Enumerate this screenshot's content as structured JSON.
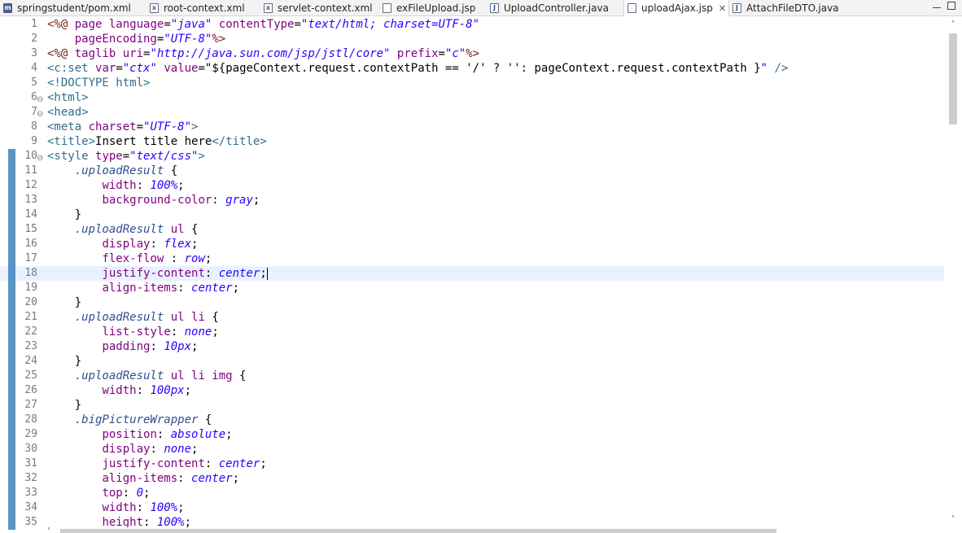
{
  "tabs": [
    {
      "label": "springstudent/pom.xml",
      "icon": "maven-file-icon",
      "active": false
    },
    {
      "label": "root-context.xml",
      "icon": "xml-file-icon",
      "active": false
    },
    {
      "label": "servlet-context.xml",
      "icon": "xml-file-icon",
      "active": false
    },
    {
      "label": "exFileUpload.jsp",
      "icon": "jsp-file-icon",
      "active": false
    },
    {
      "label": "UploadController.java",
      "icon": "java-file-icon",
      "active": false
    },
    {
      "label": "uploadAjax.jsp",
      "icon": "jsp-file-icon",
      "active": true,
      "close": "✕"
    },
    {
      "label": "AttachFileDTO.java",
      "icon": "java-file-icon",
      "active": false
    }
  ],
  "editor": {
    "current_line": 18,
    "lines": [
      {
        "n": "1",
        "segs": [
          [
            "dir",
            "<%@ "
          ],
          [
            "att",
            "page "
          ],
          [
            "att",
            "language"
          ],
          [
            "plain",
            "="
          ],
          [
            "val",
            "\"java\""
          ],
          [
            "plain",
            " "
          ],
          [
            "att",
            "contentType"
          ],
          [
            "plain",
            "="
          ],
          [
            "val",
            "\"text/html; charset=UTF-8\""
          ]
        ]
      },
      {
        "n": "2",
        "segs": [
          [
            "plain",
            "    "
          ],
          [
            "att",
            "pageEncoding"
          ],
          [
            "plain",
            "="
          ],
          [
            "val",
            "\"UTF-8\""
          ],
          [
            "dir",
            "%>"
          ]
        ]
      },
      {
        "n": "3",
        "segs": [
          [
            "dir",
            "<%@ "
          ],
          [
            "att",
            "taglib "
          ],
          [
            "att",
            "uri"
          ],
          [
            "plain",
            "="
          ],
          [
            "val",
            "\"http://java.sun.com/jsp/jstl/core\""
          ],
          [
            "plain",
            " "
          ],
          [
            "att",
            "prefix"
          ],
          [
            "plain",
            "="
          ],
          [
            "val",
            "\"c\""
          ],
          [
            "dir",
            "%>"
          ]
        ]
      },
      {
        "n": "4",
        "segs": [
          [
            "tag",
            "<c:set "
          ],
          [
            "att",
            "var"
          ],
          [
            "plain",
            "="
          ],
          [
            "val",
            "\"ctx\""
          ],
          [
            "plain",
            " "
          ],
          [
            "att",
            "value"
          ],
          [
            "plain",
            "=\"${pageContext.request.contextPath == '/' ? '': pageContext.request.contextPath }"
          ],
          [
            "val",
            "\""
          ],
          [
            "tag",
            " />"
          ]
        ]
      },
      {
        "n": "5",
        "segs": [
          [
            "tag",
            "<!DOCTYPE html>"
          ]
        ]
      },
      {
        "n": "6",
        "fold": "⊖",
        "segs": [
          [
            "tag",
            "<html>"
          ]
        ]
      },
      {
        "n": "7",
        "fold": "⊖",
        "segs": [
          [
            "tag",
            "<head>"
          ]
        ]
      },
      {
        "n": "8",
        "segs": [
          [
            "tag",
            "<meta "
          ],
          [
            "att",
            "charset"
          ],
          [
            "plain",
            "="
          ],
          [
            "val",
            "\"UTF-8\""
          ],
          [
            "tag",
            ">"
          ]
        ]
      },
      {
        "n": "9",
        "segs": [
          [
            "tag",
            "<title>"
          ],
          [
            "plain",
            "Insert title here"
          ],
          [
            "tag",
            "</title>"
          ]
        ]
      },
      {
        "n": "10",
        "fold": "⊖",
        "bar": true,
        "segs": [
          [
            "tag",
            "<style "
          ],
          [
            "att",
            "type"
          ],
          [
            "plain",
            "="
          ],
          [
            "val",
            "\"text/css\""
          ],
          [
            "tag",
            ">"
          ]
        ]
      },
      {
        "n": "11",
        "bar": true,
        "segs": [
          [
            "plain",
            "    "
          ],
          [
            "sel",
            ".uploadResult"
          ],
          [
            "plain",
            " {"
          ]
        ]
      },
      {
        "n": "12",
        "bar": true,
        "segs": [
          [
            "plain",
            "        "
          ],
          [
            "prop",
            "width"
          ],
          [
            "plain",
            ": "
          ],
          [
            "pv",
            "100%"
          ],
          [
            "plain",
            ";"
          ]
        ]
      },
      {
        "n": "13",
        "bar": true,
        "segs": [
          [
            "plain",
            "        "
          ],
          [
            "prop",
            "background-color"
          ],
          [
            "plain",
            ": "
          ],
          [
            "pv",
            "gray"
          ],
          [
            "plain",
            ";"
          ]
        ]
      },
      {
        "n": "14",
        "bar": true,
        "segs": [
          [
            "plain",
            "    }"
          ]
        ]
      },
      {
        "n": "15",
        "bar": true,
        "segs": [
          [
            "plain",
            "    "
          ],
          [
            "sel",
            ".uploadResult"
          ],
          [
            "plain",
            " "
          ],
          [
            "prop",
            "ul"
          ],
          [
            "plain",
            " {"
          ]
        ]
      },
      {
        "n": "16",
        "bar": true,
        "segs": [
          [
            "plain",
            "        "
          ],
          [
            "prop",
            "display"
          ],
          [
            "plain",
            ": "
          ],
          [
            "pv",
            "flex"
          ],
          [
            "plain",
            ";"
          ]
        ]
      },
      {
        "n": "17",
        "bar": true,
        "segs": [
          [
            "plain",
            "        "
          ],
          [
            "prop",
            "flex-flow"
          ],
          [
            "plain",
            " : "
          ],
          [
            "pv",
            "row"
          ],
          [
            "plain",
            ";"
          ]
        ]
      },
      {
        "n": "18",
        "bar": true,
        "caret": true,
        "segs": [
          [
            "plain",
            "        "
          ],
          [
            "prop",
            "justify-content"
          ],
          [
            "plain",
            ": "
          ],
          [
            "pv",
            "center"
          ],
          [
            "plain",
            ";"
          ]
        ]
      },
      {
        "n": "19",
        "bar": true,
        "segs": [
          [
            "plain",
            "        "
          ],
          [
            "prop",
            "align-items"
          ],
          [
            "plain",
            ": "
          ],
          [
            "pv",
            "center"
          ],
          [
            "plain",
            ";"
          ]
        ]
      },
      {
        "n": "20",
        "bar": true,
        "segs": [
          [
            "plain",
            "    }"
          ]
        ]
      },
      {
        "n": "21",
        "bar": true,
        "segs": [
          [
            "plain",
            "    "
          ],
          [
            "sel",
            ".uploadResult"
          ],
          [
            "plain",
            " "
          ],
          [
            "prop",
            "ul li"
          ],
          [
            "plain",
            " {"
          ]
        ]
      },
      {
        "n": "22",
        "bar": true,
        "segs": [
          [
            "plain",
            "        "
          ],
          [
            "prop",
            "list-style"
          ],
          [
            "plain",
            ": "
          ],
          [
            "pv",
            "none"
          ],
          [
            "plain",
            ";"
          ]
        ]
      },
      {
        "n": "23",
        "bar": true,
        "segs": [
          [
            "plain",
            "        "
          ],
          [
            "prop",
            "padding"
          ],
          [
            "plain",
            ": "
          ],
          [
            "pv",
            "10px"
          ],
          [
            "plain",
            ";"
          ]
        ]
      },
      {
        "n": "24",
        "bar": true,
        "segs": [
          [
            "plain",
            "    }"
          ]
        ]
      },
      {
        "n": "25",
        "bar": true,
        "segs": [
          [
            "plain",
            "    "
          ],
          [
            "sel",
            ".uploadResult"
          ],
          [
            "plain",
            " "
          ],
          [
            "prop",
            "ul li img"
          ],
          [
            "plain",
            " {"
          ]
        ]
      },
      {
        "n": "26",
        "bar": true,
        "segs": [
          [
            "plain",
            "        "
          ],
          [
            "prop",
            "width"
          ],
          [
            "plain",
            ": "
          ],
          [
            "pv",
            "100px"
          ],
          [
            "plain",
            ";"
          ]
        ]
      },
      {
        "n": "27",
        "bar": true,
        "segs": [
          [
            "plain",
            "    }"
          ]
        ]
      },
      {
        "n": "28",
        "bar": true,
        "segs": [
          [
            "plain",
            "    "
          ],
          [
            "sel",
            ".bigPictureWrapper"
          ],
          [
            "plain",
            " {"
          ]
        ]
      },
      {
        "n": "29",
        "bar": true,
        "segs": [
          [
            "plain",
            "        "
          ],
          [
            "prop",
            "position"
          ],
          [
            "plain",
            ": "
          ],
          [
            "pv",
            "absolute"
          ],
          [
            "plain",
            ";"
          ]
        ]
      },
      {
        "n": "30",
        "bar": true,
        "segs": [
          [
            "plain",
            "        "
          ],
          [
            "prop",
            "display"
          ],
          [
            "plain",
            ": "
          ],
          [
            "pv",
            "none"
          ],
          [
            "plain",
            ";"
          ]
        ]
      },
      {
        "n": "31",
        "bar": true,
        "segs": [
          [
            "plain",
            "        "
          ],
          [
            "prop",
            "justify-content"
          ],
          [
            "plain",
            ": "
          ],
          [
            "pv",
            "center"
          ],
          [
            "plain",
            ";"
          ]
        ]
      },
      {
        "n": "32",
        "bar": true,
        "segs": [
          [
            "plain",
            "        "
          ],
          [
            "prop",
            "align-items"
          ],
          [
            "plain",
            ": "
          ],
          [
            "pv",
            "center"
          ],
          [
            "plain",
            ";"
          ]
        ]
      },
      {
        "n": "33",
        "bar": true,
        "segs": [
          [
            "plain",
            "        "
          ],
          [
            "prop",
            "top"
          ],
          [
            "plain",
            ": "
          ],
          [
            "pv",
            "0"
          ],
          [
            "plain",
            ";"
          ]
        ]
      },
      {
        "n": "34",
        "bar": true,
        "segs": [
          [
            "plain",
            "        "
          ],
          [
            "prop",
            "width"
          ],
          [
            "plain",
            ": "
          ],
          [
            "pv",
            "100%"
          ],
          [
            "plain",
            ";"
          ]
        ]
      },
      {
        "n": "35",
        "bar": true,
        "segs": [
          [
            "plain",
            "        "
          ],
          [
            "prop",
            "height"
          ],
          [
            "plain",
            ": "
          ],
          [
            "pv",
            "100%"
          ],
          [
            "plain",
            ";"
          ]
        ]
      }
    ]
  },
  "scrollbars": {
    "up_arrow": "˄",
    "down_arrow": "˅",
    "left_arrow": "‹"
  }
}
